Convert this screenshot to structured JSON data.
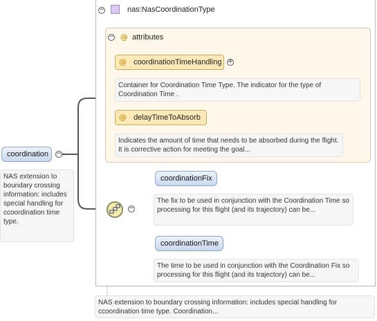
{
  "type": {
    "name": "nas:NasCoordinationType",
    "attributes_label": "attributes",
    "attributes": [
      {
        "name": "coordinationTimeHandling",
        "doc": "Container for Coordination Time Type. The indicator for the type of Coordination Time ."
      },
      {
        "name": "delayTimeToAbsorb",
        "doc": "Indicates the amount of time that needs to be absorbed during the flight. It is corrective action for meeting the goal..."
      }
    ],
    "doc": "NAS extension to boundary crossing information: includes special handling for ccoordination time type. Coordination..."
  },
  "root": {
    "name": "coordination",
    "doc": "NAS extension to boundary crossing information: includes special handling for ccoordination time type."
  },
  "children": [
    {
      "name": "coordinationFix",
      "doc": "The fix to be used in conjunction with the Coordination Time so processing for this flight (and its trajectory) can be..."
    },
    {
      "name": "coordinationTime",
      "doc": "The time to be used in conjunction with the Coordination Fix so processing for this flight (and its trajectory) can be..."
    }
  ],
  "glyphs": {
    "collapse": "−",
    "expand": "+",
    "attribute": "@"
  },
  "colors": {
    "element_fill": "#c9d8ef",
    "attribute_fill": "#fbe9b8",
    "attributes_panel": "#fdf8ea",
    "type_icon": "#d9ccee"
  }
}
